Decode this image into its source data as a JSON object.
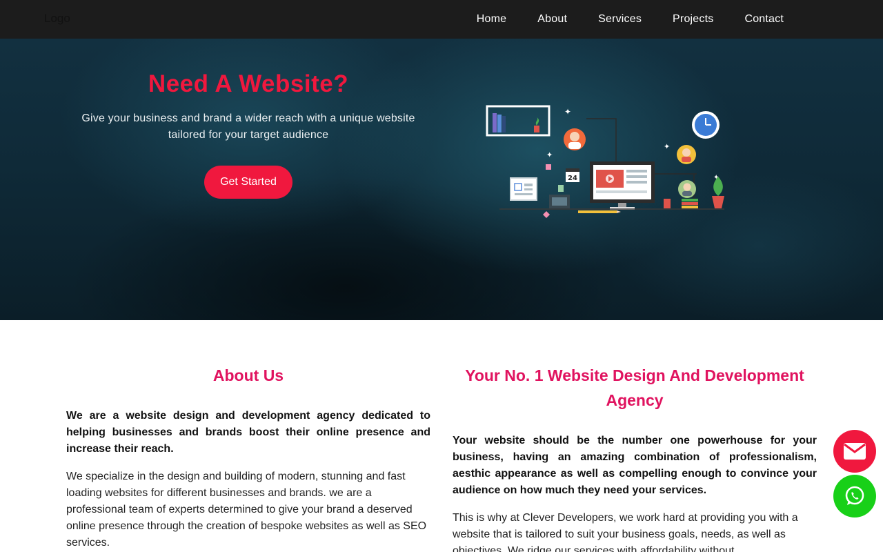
{
  "navbar": {
    "logo": "Logo",
    "links": [
      "Home",
      "About",
      "Services",
      "Projects",
      "Contact"
    ]
  },
  "hero": {
    "title": "Need A Website?",
    "subtitle": "Give your business and brand a wider reach with a unique website tailored for your target audience",
    "cta_label": "Get Started",
    "calendar_day": "24",
    "illustration_icon": "web-design-workspace-illustration"
  },
  "about": {
    "title": "About Us",
    "lead": "We are a website design and development agency dedicated to helping businesses and brands boost their online presence and increase their reach.",
    "body": "We specialize in the design and building of modern, stunning and fast loading websites for different businesses and brands. we are a professional team of experts determined to give your brand a deserved online presence through the creation of bespoke websites as well as SEO services."
  },
  "agency": {
    "title": "Your No. 1 Website Design And Development Agency",
    "lead": "Your website should be the number one powerhouse for your business, having an amazing combination of professionalism, aesthic appearance as well as compelling enough to convince your audience on how much they need your services.",
    "body": "This is why at Clever Developers, we work hard at providing you with a website that is tailored to suit your business goals, needs, as well as objectives. We ridge our services with affordability without"
  },
  "floating": {
    "email_icon": "envelope-icon",
    "whatsapp_icon": "whatsapp-icon"
  },
  "colors": {
    "accent": "#f0183e",
    "section_title": "#e0135f",
    "navbar_bg": "#1c1c1c",
    "whatsapp": "#18d018"
  }
}
